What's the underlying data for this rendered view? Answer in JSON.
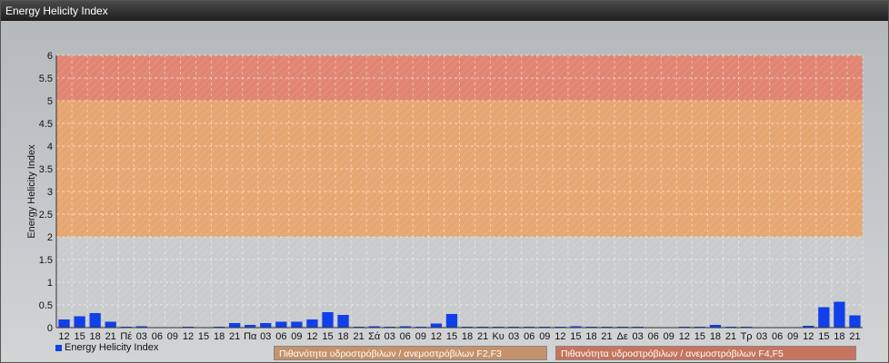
{
  "window": {
    "title": "Energy Helicity Index"
  },
  "colors": {
    "bar": "#1040e8",
    "zone_f23": "#e9a46a",
    "zone_f45": "#e4806c",
    "zone_low": "#c9cbcd"
  },
  "legend": {
    "series_label": "Energy Helicity Index"
  },
  "zones": [
    {
      "label": "Πιθανότητα υδροστρόβιλων / ανεμοστρόβιλων F2,F3",
      "from": 2,
      "to": 5
    },
    {
      "label": "Πιθανότητα υδροστρόβιλων / ανεμοστρόβιλων F4,F5",
      "from": 5,
      "to": 6
    }
  ],
  "chart_data": {
    "type": "bar",
    "ylabel": "Energy Helicity Index",
    "ylim": [
      0,
      6
    ],
    "yticks": [
      "0",
      "0.5",
      "1",
      "1.5",
      "2",
      "2.5",
      "3",
      "3.5",
      "4",
      "4.5",
      "5",
      "5.5",
      "6"
    ],
    "grid": true,
    "categories": [
      "12",
      "15",
      "18",
      "21",
      "Πέ",
      "03",
      "06",
      "09",
      "12",
      "15",
      "18",
      "21",
      "Πα",
      "03",
      "06",
      "09",
      "12",
      "15",
      "18",
      "21",
      "Σά",
      "03",
      "06",
      "09",
      "12",
      "15",
      "18",
      "21",
      "Κυ",
      "03",
      "06",
      "09",
      "12",
      "15",
      "18",
      "21",
      "Δε",
      "03",
      "06",
      "09",
      "12",
      "15",
      "18",
      "21",
      "Τρ",
      "03",
      "06",
      "09",
      "12",
      "15",
      "18",
      "21"
    ],
    "series": [
      {
        "name": "Energy Helicity Index",
        "values": [
          0.18,
          0.25,
          0.32,
          0.13,
          0.02,
          0.03,
          0.01,
          0.01,
          0.02,
          0.01,
          0.02,
          0.1,
          0.06,
          0.1,
          0.13,
          0.13,
          0.18,
          0.34,
          0.28,
          0.02,
          0.03,
          0.02,
          0.03,
          0.02,
          0.09,
          0.3,
          0.02,
          0.02,
          0.02,
          0.02,
          0.02,
          0.02,
          0.02,
          0.03,
          0.02,
          0.02,
          0.02,
          0.02,
          0.01,
          0.01,
          0.02,
          0.02,
          0.06,
          0.02,
          0.02,
          0.01,
          0.01,
          0.01,
          0.04,
          0.45,
          0.57,
          0.27
        ]
      }
    ]
  }
}
